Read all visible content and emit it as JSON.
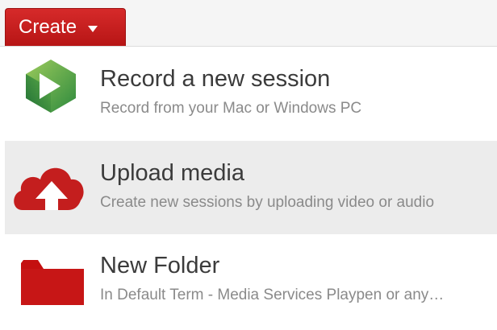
{
  "toolbar": {
    "create_label": "Create",
    "accent_color": "#c41e1e"
  },
  "menu": {
    "items": [
      {
        "title": "Record a new session",
        "description": "Record from your Mac or Windows PC",
        "icon": "panopto-logo-icon"
      },
      {
        "title": "Upload media",
        "description": "Create new sessions by uploading video or audio",
        "icon": "cloud-upload-icon"
      },
      {
        "title": "New Folder",
        "description": "In Default Term - Media Services Playpen or any…",
        "icon": "folder-icon"
      }
    ]
  }
}
